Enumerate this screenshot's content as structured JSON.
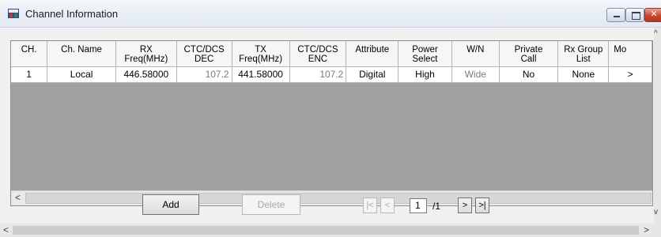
{
  "window": {
    "title": "Channel Information",
    "icon": "channel-info-icon"
  },
  "table": {
    "columns": [
      {
        "label": "CH."
      },
      {
        "label": "Ch. Name"
      },
      {
        "label": "RX Freq(MHz)"
      },
      {
        "label": "CTC/DCS DEC"
      },
      {
        "label": "TX Freq(MHz)"
      },
      {
        "label": "CTC/DCS ENC"
      },
      {
        "label": "Attribute"
      },
      {
        "label": "Power Select"
      },
      {
        "label": "W/N"
      },
      {
        "label": "Private Call"
      },
      {
        "label": "Rx Group List"
      },
      {
        "label": "Mo"
      }
    ],
    "rows": [
      {
        "ch": "1",
        "name": "Local",
        "rx_freq": "446.58000",
        "dec": "107.2",
        "tx_freq": "441.58000",
        "enc": "107.2",
        "attribute": "Digital",
        "power": "High",
        "wn": "Wide",
        "private_call": "No",
        "rx_group": "None",
        "more": ">"
      }
    ]
  },
  "buttons": {
    "add": "Add",
    "delete": "Delete",
    "first": "|<",
    "prev": "<",
    "next": ">",
    "last": ">|"
  },
  "pager": {
    "current": "1",
    "total": "/1"
  },
  "scroll": {
    "left_arrow": "<",
    "right_arrow": ">",
    "up_arrow": "^",
    "down_arrow": "v"
  }
}
